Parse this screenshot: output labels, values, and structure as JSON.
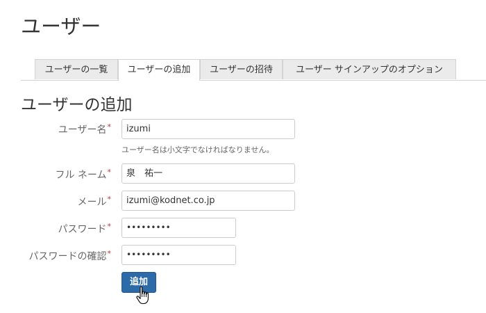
{
  "page": {
    "title": "ユーザー"
  },
  "tabs": [
    {
      "label": "ユーザーの一覧",
      "active": false
    },
    {
      "label": "ユーザーの追加",
      "active": true
    },
    {
      "label": "ユーザーの招待",
      "active": false
    },
    {
      "label": "ユーザー サインアップのオプション",
      "active": false
    }
  ],
  "form": {
    "title": "ユーザーの追加",
    "required_marker": "*",
    "username": {
      "label": "ユーザー名",
      "value": "izumi",
      "help": "ユーザー名は小文字でなければなりません。"
    },
    "fullname": {
      "label": "フル ネーム",
      "value": "泉　祐一"
    },
    "email": {
      "label": "メール",
      "value": "izumi@kodnet.co.jp"
    },
    "password": {
      "label": "パスワード",
      "value": "•••••••••"
    },
    "password_confirm": {
      "label": "パスワードの確認",
      "value": "•••••••••"
    },
    "submit_label": "追加"
  },
  "colors": {
    "primary_button": "#2c6aa8",
    "required_marker": "#c0392b",
    "tab_inactive_bg": "#ebebeb"
  },
  "icons": {
    "cursor": "hand-pointer-icon"
  }
}
